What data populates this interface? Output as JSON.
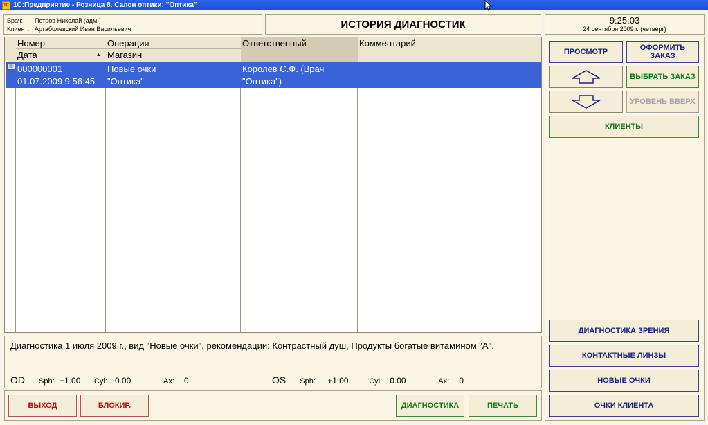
{
  "window": {
    "title": "1С:Предприятие - Розница 8. Салон оптики: \"Оптика\"",
    "app_icon_text": "1С"
  },
  "info": {
    "doctor_label": "Врач:",
    "doctor_value": "Петров Николай (адм.)",
    "client_label": "Клиент:",
    "client_value": "Артаболевский Иван Васильевич"
  },
  "page_title": "ИСТОРИЯ ДИАГНОСТИК",
  "clock": {
    "time": "9:25:03",
    "date": "24 сентября 2009 г. (четверг)"
  },
  "grid": {
    "columns": [
      {
        "top": "Номер",
        "bottom": "Дата"
      },
      {
        "top": "Операция",
        "bottom": "Магазин"
      },
      {
        "top": "Ответственный",
        "bottom": ""
      },
      {
        "top": "Комментарий",
        "bottom": ""
      }
    ],
    "rows": [
      {
        "number": "000000001",
        "date": "01.07.2009 9:56:45",
        "operation": "Новые очки",
        "store": "\"Оптика\"",
        "responsible_1": "Королев С.Ф. (Врач",
        "responsible_2": "\"Оптика\")",
        "comment": ""
      }
    ]
  },
  "details": {
    "text": "Диагностика 1 июля 2009 г., вид \"Новые очки\", рекомендации: Контрастный душ, Продукты богатые витамином \"А\".",
    "od": {
      "name": "OD",
      "sph_label": "Sph:",
      "sph": "+1.00",
      "cyl_label": "Cyl:",
      "cyl": "0.00",
      "ax_label": "Ax:",
      "ax": "0"
    },
    "os": {
      "name": "OS",
      "sph_label": "Sph:",
      "sph": "+1.00",
      "cyl_label": "Cyl:",
      "cyl": "0.00",
      "ax_label": "Ax:",
      "ax": "0"
    }
  },
  "buttons": {
    "view": "ПРОСМОТР",
    "make_order": "ОФОРМИТЬ ЗАКАЗ",
    "select_order": "ВЫБРАТЬ ЗАКАЗ",
    "level_up": "УРОВЕНЬ ВВЕРХ",
    "clients": "КЛИЕНТЫ",
    "vision_diag": "ДИАГНОСТИКА ЗРЕНИЯ",
    "contact_lenses": "КОНТАКТНЫЕ ЛИНЗЫ",
    "new_glasses": "НОВЫЕ ОЧКИ",
    "client_glasses": "ОЧКИ КЛИЕНТА",
    "exit": "ВЫХОД",
    "block": "БЛОКИР.",
    "diagnostics": "ДИАГНОСТИКА",
    "print": "ПЕЧАТЬ"
  },
  "colors": {
    "titlebar": "#1a4fd6",
    "selection": "#3a63d8",
    "navy": "#1a2380",
    "green": "#0f7a13",
    "red": "#b11212",
    "background": "#f7f3e6"
  }
}
